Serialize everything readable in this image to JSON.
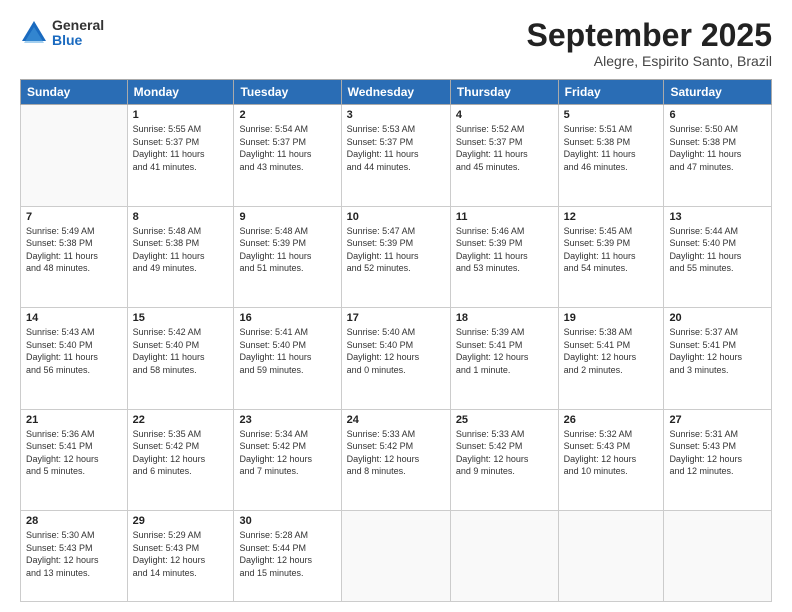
{
  "header": {
    "logo": {
      "general": "General",
      "blue": "Blue"
    },
    "title": "September 2025",
    "location": "Alegre, Espirito Santo, Brazil"
  },
  "weekdays": [
    "Sunday",
    "Monday",
    "Tuesday",
    "Wednesday",
    "Thursday",
    "Friday",
    "Saturday"
  ],
  "weeks": [
    [
      {
        "day": "",
        "info": ""
      },
      {
        "day": "1",
        "info": "Sunrise: 5:55 AM\nSunset: 5:37 PM\nDaylight: 11 hours\nand 41 minutes."
      },
      {
        "day": "2",
        "info": "Sunrise: 5:54 AM\nSunset: 5:37 PM\nDaylight: 11 hours\nand 43 minutes."
      },
      {
        "day": "3",
        "info": "Sunrise: 5:53 AM\nSunset: 5:37 PM\nDaylight: 11 hours\nand 44 minutes."
      },
      {
        "day": "4",
        "info": "Sunrise: 5:52 AM\nSunset: 5:37 PM\nDaylight: 11 hours\nand 45 minutes."
      },
      {
        "day": "5",
        "info": "Sunrise: 5:51 AM\nSunset: 5:38 PM\nDaylight: 11 hours\nand 46 minutes."
      },
      {
        "day": "6",
        "info": "Sunrise: 5:50 AM\nSunset: 5:38 PM\nDaylight: 11 hours\nand 47 minutes."
      }
    ],
    [
      {
        "day": "7",
        "info": "Sunrise: 5:49 AM\nSunset: 5:38 PM\nDaylight: 11 hours\nand 48 minutes."
      },
      {
        "day": "8",
        "info": "Sunrise: 5:48 AM\nSunset: 5:38 PM\nDaylight: 11 hours\nand 49 minutes."
      },
      {
        "day": "9",
        "info": "Sunrise: 5:48 AM\nSunset: 5:39 PM\nDaylight: 11 hours\nand 51 minutes."
      },
      {
        "day": "10",
        "info": "Sunrise: 5:47 AM\nSunset: 5:39 PM\nDaylight: 11 hours\nand 52 minutes."
      },
      {
        "day": "11",
        "info": "Sunrise: 5:46 AM\nSunset: 5:39 PM\nDaylight: 11 hours\nand 53 minutes."
      },
      {
        "day": "12",
        "info": "Sunrise: 5:45 AM\nSunset: 5:39 PM\nDaylight: 11 hours\nand 54 minutes."
      },
      {
        "day": "13",
        "info": "Sunrise: 5:44 AM\nSunset: 5:40 PM\nDaylight: 11 hours\nand 55 minutes."
      }
    ],
    [
      {
        "day": "14",
        "info": "Sunrise: 5:43 AM\nSunset: 5:40 PM\nDaylight: 11 hours\nand 56 minutes."
      },
      {
        "day": "15",
        "info": "Sunrise: 5:42 AM\nSunset: 5:40 PM\nDaylight: 11 hours\nand 58 minutes."
      },
      {
        "day": "16",
        "info": "Sunrise: 5:41 AM\nSunset: 5:40 PM\nDaylight: 11 hours\nand 59 minutes."
      },
      {
        "day": "17",
        "info": "Sunrise: 5:40 AM\nSunset: 5:40 PM\nDaylight: 12 hours\nand 0 minutes."
      },
      {
        "day": "18",
        "info": "Sunrise: 5:39 AM\nSunset: 5:41 PM\nDaylight: 12 hours\nand 1 minute."
      },
      {
        "day": "19",
        "info": "Sunrise: 5:38 AM\nSunset: 5:41 PM\nDaylight: 12 hours\nand 2 minutes."
      },
      {
        "day": "20",
        "info": "Sunrise: 5:37 AM\nSunset: 5:41 PM\nDaylight: 12 hours\nand 3 minutes."
      }
    ],
    [
      {
        "day": "21",
        "info": "Sunrise: 5:36 AM\nSunset: 5:41 PM\nDaylight: 12 hours\nand 5 minutes."
      },
      {
        "day": "22",
        "info": "Sunrise: 5:35 AM\nSunset: 5:42 PM\nDaylight: 12 hours\nand 6 minutes."
      },
      {
        "day": "23",
        "info": "Sunrise: 5:34 AM\nSunset: 5:42 PM\nDaylight: 12 hours\nand 7 minutes."
      },
      {
        "day": "24",
        "info": "Sunrise: 5:33 AM\nSunset: 5:42 PM\nDaylight: 12 hours\nand 8 minutes."
      },
      {
        "day": "25",
        "info": "Sunrise: 5:33 AM\nSunset: 5:42 PM\nDaylight: 12 hours\nand 9 minutes."
      },
      {
        "day": "26",
        "info": "Sunrise: 5:32 AM\nSunset: 5:43 PM\nDaylight: 12 hours\nand 10 minutes."
      },
      {
        "day": "27",
        "info": "Sunrise: 5:31 AM\nSunset: 5:43 PM\nDaylight: 12 hours\nand 12 minutes."
      }
    ],
    [
      {
        "day": "28",
        "info": "Sunrise: 5:30 AM\nSunset: 5:43 PM\nDaylight: 12 hours\nand 13 minutes."
      },
      {
        "day": "29",
        "info": "Sunrise: 5:29 AM\nSunset: 5:43 PM\nDaylight: 12 hours\nand 14 minutes."
      },
      {
        "day": "30",
        "info": "Sunrise: 5:28 AM\nSunset: 5:44 PM\nDaylight: 12 hours\nand 15 minutes."
      },
      {
        "day": "",
        "info": ""
      },
      {
        "day": "",
        "info": ""
      },
      {
        "day": "",
        "info": ""
      },
      {
        "day": "",
        "info": ""
      }
    ]
  ]
}
